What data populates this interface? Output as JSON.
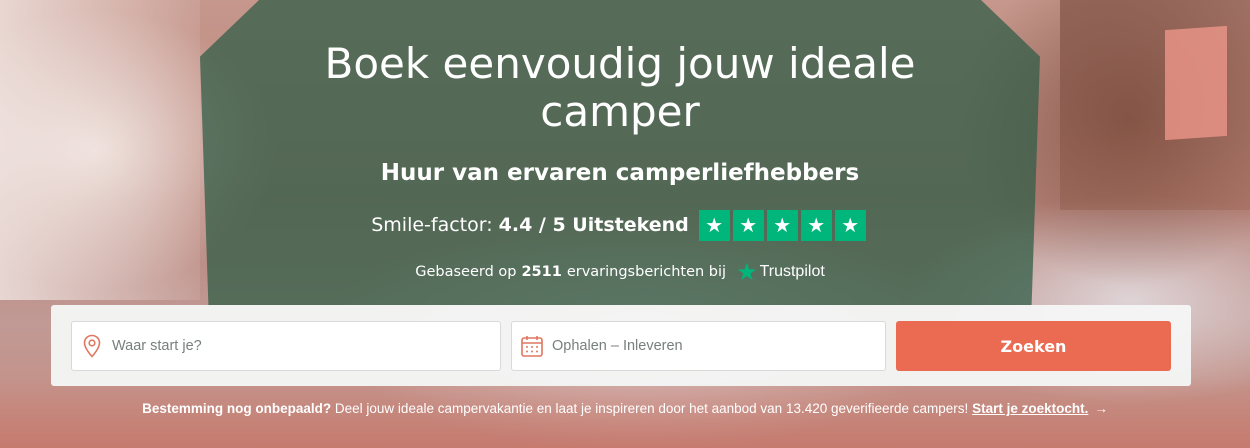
{
  "hero": {
    "title": "Boek eenvoudig jouw ideale camper",
    "subtitle": "Huur van ervaren camperliefhebbers",
    "colors": {
      "overlay": "#335f48",
      "star": "#00b67a",
      "button": "#ea6a52"
    }
  },
  "rating": {
    "label": "Smile-factor:",
    "score": "4.4 / 5 Uitstekend",
    "stars": 5,
    "star_icon": "star-icon"
  },
  "reviews": {
    "prefix": "Gebaseerd op",
    "count": "2511",
    "suffix": "ervaringsberichten bij",
    "brand": "Trustpilot"
  },
  "search": {
    "location_placeholder": "Waar start je?",
    "location_icon": "map-pin-icon",
    "dates_placeholder": "Ophalen – Inleveren",
    "dates_icon": "calendar-icon",
    "button_label": "Zoeken"
  },
  "footer": {
    "lead": "Bestemming nog onbepaald?",
    "text": "Deel jouw ideale campervakantie en laat je inspireren door het aanbod van 13.420 geverifieerde campers!",
    "link": "Start je zoektocht.",
    "arrow": "→"
  }
}
